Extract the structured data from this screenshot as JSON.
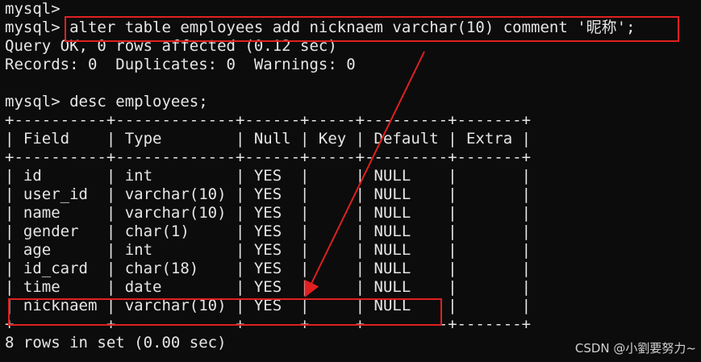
{
  "terminal": {
    "lines": [
      "mysql>",
      "mysql> alter table employees add nicknaem varchar(10) comment '昵称';",
      "Query OK, 0 rows affected (0.12 sec)",
      "Records: 0  Duplicates: 0  Warnings: 0",
      "",
      "mysql> desc employees;",
      "+----------+-------------+------+-----+---------+-------+",
      "| Field    | Type        | Null | Key | Default | Extra |",
      "+----------+-------------+------+-----+---------+-------+",
      "| id       | int         | YES  |     | NULL    |       |",
      "| user_id  | varchar(10) | YES  |     | NULL    |       |",
      "| name     | varchar(10) | YES  |     | NULL    |       |",
      "| gender   | char(1)     | YES  |     | NULL    |       |",
      "| age      | int         | YES  |     | NULL    |       |",
      "| id_card  | char(18)    | YES  |     | NULL    |       |",
      "| time     | date        | YES  |     | NULL    |       |",
      "| nicknaem | varchar(10) | YES  |     | NULL    |       |",
      "+----------+-------------+------+-----+---------+-------+",
      "8 rows in set (0.00 sec)"
    ]
  },
  "watermark": "CSDN @小劉要努力~",
  "colors": {
    "background": "#0c0c0c",
    "text": "#e6e6e6",
    "annotation": "#e02020"
  }
}
